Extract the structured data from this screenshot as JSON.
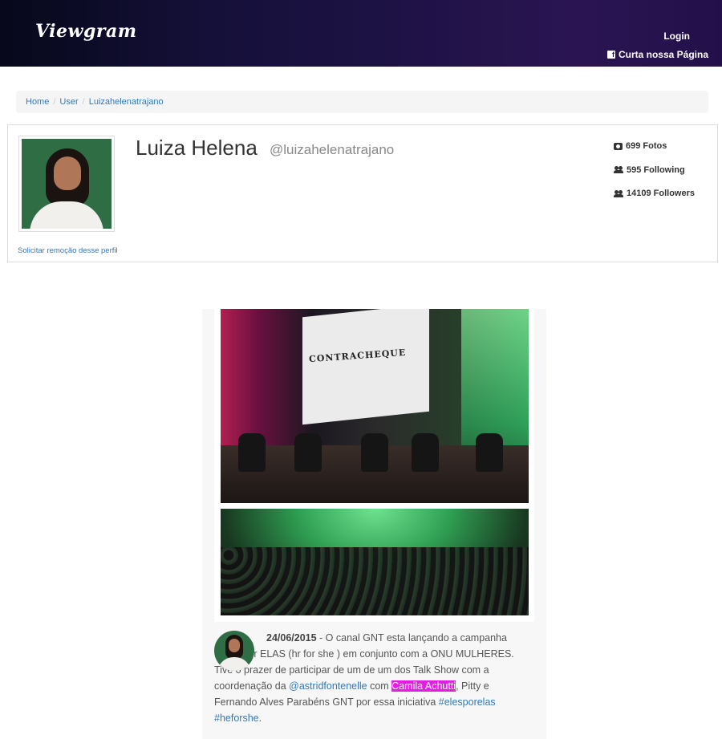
{
  "navbar": {
    "logo": "Viewgram",
    "login": "Login",
    "facebook": "Curta nossa Página",
    "facebook_icon": "facebook-square-icon"
  },
  "breadcrumb": {
    "items": [
      "Home",
      "User",
      "Luizahelenatrajano"
    ]
  },
  "profile": {
    "name": "Luiza Helena",
    "handle": "@luizahelenatrajano",
    "remove_link": "Solicitar remoção desse perfil",
    "stats": {
      "photos": "699 Fotos",
      "following": "595 Following",
      "followers": "14109 Followers"
    }
  },
  "post": {
    "photo_text": "CONTRACHEQUE",
    "date": "24/06/2015",
    "text_1": " - O canal GNT esta lançando a campanha ELES por ELAS (hr for she ) em conjunto com a ONU MULHERES. Tive o prazer de participar de um de um dos Talk Show com a coordenação da ",
    "mention": "@astridfontenelle",
    "text_2": " com ",
    "highlight": "Camila Achutti",
    "text_3": ", Pitty e Fernando Alves Parabéns GNT por essa iniciativa ",
    "hashtag_1": "#elesporelas",
    "hashtag_2": "#heforshe",
    "text_4": "."
  },
  "colors": {
    "link": "#337ab7",
    "highlight": "#e020e0",
    "navbar_dark": "#07081a",
    "navbar_purple": "#2a1552"
  }
}
